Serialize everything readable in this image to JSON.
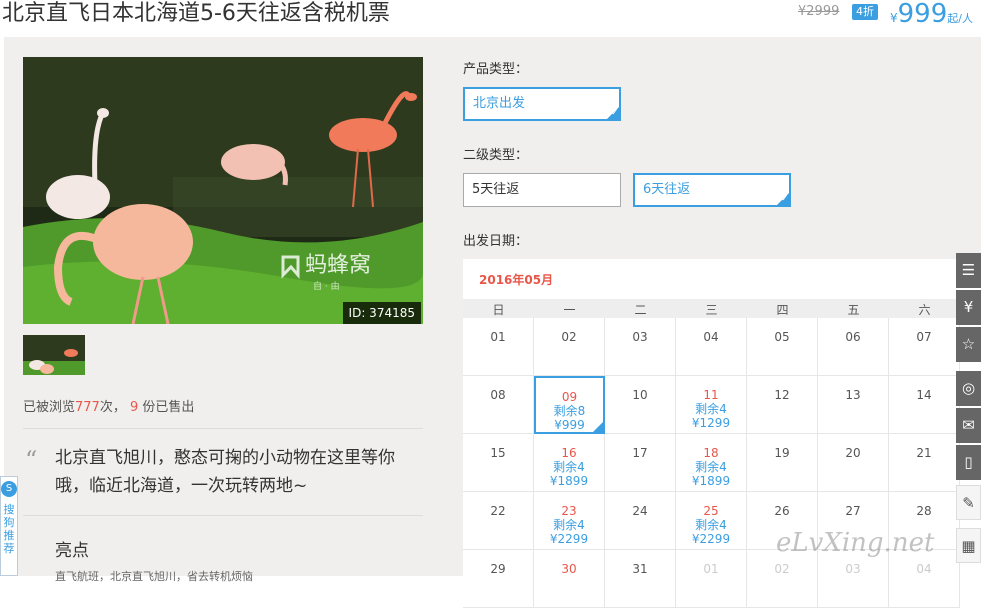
{
  "header": {
    "title": "北京直飞日本北海道5-6天往返含税机票",
    "original_price": "¥2999",
    "discount_badge": "4折",
    "price_symbol": "¥",
    "price": "999",
    "price_unit": "起/人"
  },
  "gallery": {
    "photo_id": "ID: 374185",
    "watermark_text": "蚂蜂窝",
    "watermark_sub": "自 · 由"
  },
  "stats": {
    "prefix": "已被浏览",
    "views": "777",
    "views_suffix": "次，",
    "sold": "9",
    "sold_suffix": "份已售出"
  },
  "description": {
    "quote": "北京直飞旭川，憨态可掬的小动物在这里等你哦，临近北海道，一次玩转两地~",
    "highlights_title": "亮点",
    "highlight_item": "直飞航班，北京直飞旭川，省去转机烦恼"
  },
  "options": {
    "product_type_label": "产品类型：",
    "product_types": [
      "北京出发"
    ],
    "sub_type_label": "二级类型：",
    "sub_types": [
      "5天往返",
      "6天往返"
    ],
    "date_label": "出发日期："
  },
  "calendar": {
    "month": "2016年05月",
    "weekdays": [
      "日",
      "一",
      "二",
      "三",
      "四",
      "五",
      "六"
    ],
    "rows": [
      [
        {
          "d": "01"
        },
        {
          "d": "02"
        },
        {
          "d": "03"
        },
        {
          "d": "04"
        },
        {
          "d": "05"
        },
        {
          "d": "06"
        },
        {
          "d": "07"
        }
      ],
      [
        {
          "d": "08"
        },
        {
          "d": "09",
          "rem": "剩余8",
          "pr": "¥999",
          "sel": true
        },
        {
          "d": "10"
        },
        {
          "d": "11",
          "rem": "剩余4",
          "pr": "¥1299"
        },
        {
          "d": "12"
        },
        {
          "d": "13"
        },
        {
          "d": "14"
        }
      ],
      [
        {
          "d": "15"
        },
        {
          "d": "16",
          "rem": "剩余4",
          "pr": "¥1899"
        },
        {
          "d": "17"
        },
        {
          "d": "18",
          "rem": "剩余4",
          "pr": "¥1899"
        },
        {
          "d": "19"
        },
        {
          "d": "20"
        },
        {
          "d": "21"
        }
      ],
      [
        {
          "d": "22"
        },
        {
          "d": "23",
          "rem": "剩余4",
          "pr": "¥2299"
        },
        {
          "d": "24"
        },
        {
          "d": "25",
          "rem": "剩余4",
          "pr": "¥2299"
        },
        {
          "d": "26"
        },
        {
          "d": "27"
        },
        {
          "d": "28"
        }
      ],
      [
        {
          "d": "29"
        },
        {
          "d": "30",
          "avail": true
        },
        {
          "d": "31"
        },
        {
          "d": "01",
          "faded": true
        },
        {
          "d": "02",
          "faded": true
        },
        {
          "d": "03",
          "faded": true
        },
        {
          "d": "04",
          "faded": true
        }
      ]
    ]
  },
  "sidebar": {
    "icons": [
      "list-icon",
      "yen-icon",
      "star-icon",
      "weibo-icon",
      "wechat-icon",
      "mobile-icon",
      "edit-icon",
      "qr-icon"
    ]
  },
  "sogou": {
    "text": "搜狗推荐"
  },
  "site_watermark": "eLvXing.net",
  "colors": {
    "accent": "#3b9ee0",
    "highlight": "#e8564a",
    "panel_bg": "#f0efed"
  }
}
